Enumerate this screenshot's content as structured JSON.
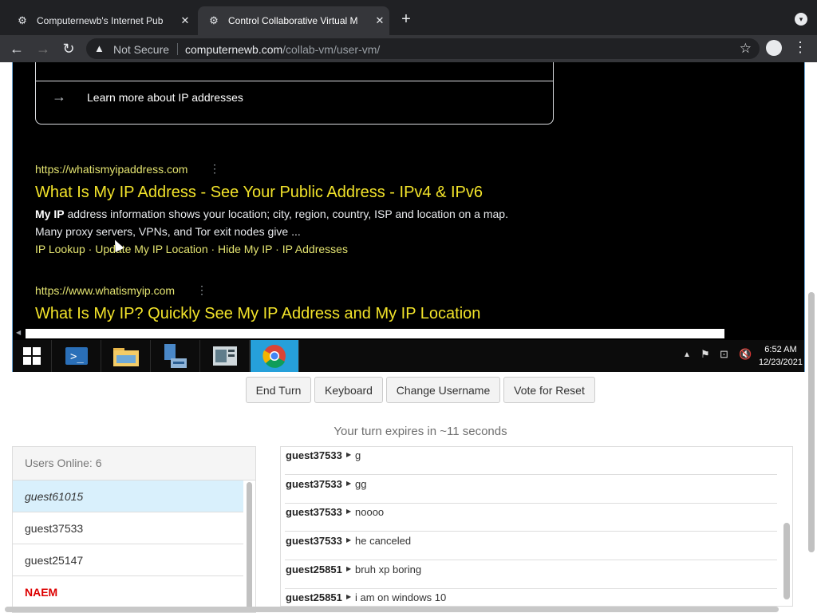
{
  "browser": {
    "tabs": [
      {
        "title": "Computernewb's Internet Pub",
        "active": false
      },
      {
        "title": "Control Collaborative Virtual M",
        "active": true
      }
    ],
    "security_label": "Not Secure",
    "url_domain": "computernewb.com",
    "url_path": "/collab-vm/user-vm/"
  },
  "vm_screen": {
    "card_link": "Learn more about IP addresses",
    "results": [
      {
        "url": "https://whatismyipaddress.com",
        "title": "What Is My IP Address - See Your Public Address - IPv4 & IPv6",
        "snippet_bold": "My IP",
        "snippet_rest": " address information shows your location; city, region, country, ISP and location on a map.",
        "snippet_line2": "Many proxy servers, VPNs, and Tor exit nodes give ...",
        "links": "IP Lookup · Update My IP Location · Hide My IP · IP Addresses"
      },
      {
        "url": "https://www.whatismyip.com",
        "title": "What Is My IP? Quickly See My IP Address and My IP Location"
      }
    ],
    "taskbar": {
      "time": "6:52 AM",
      "date": "12/23/2021"
    }
  },
  "controls": {
    "end_turn": "End Turn",
    "keyboard": "Keyboard",
    "change_username": "Change Username",
    "vote_reset": "Vote for Reset",
    "turn_status": "Your turn expires in ~11 seconds"
  },
  "users_panel": {
    "header": "Users Online: 6",
    "users": [
      "guest61015",
      "guest37533",
      "guest25147",
      "NAEM"
    ]
  },
  "chat": {
    "messages": [
      {
        "user": "guest37533",
        "text": "g"
      },
      {
        "user": "guest37533",
        "text": "gg"
      },
      {
        "user": "guest37533",
        "text": "noooo"
      },
      {
        "user": "guest37533",
        "text": "he canceled"
      },
      {
        "user": "guest25851",
        "text": "bruh xp boring"
      },
      {
        "user": "guest25851",
        "text": "i am on windows 10"
      }
    ]
  },
  "colors": {
    "link_yellow": "#f2e32a",
    "active_taskbar": "#26a0da",
    "selected_user": "#d9f0fc"
  }
}
